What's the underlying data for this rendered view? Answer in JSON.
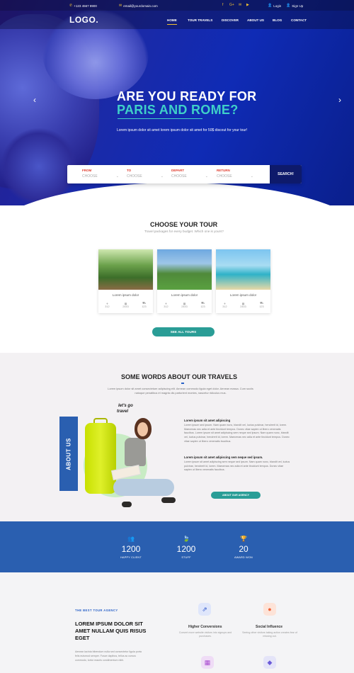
{
  "topbar": {
    "phone": "+123 4567 8900",
    "email": "email@yourdomain.com",
    "social": [
      "f",
      "G+",
      "✉",
      "▶"
    ],
    "login": "Login",
    "signup": "Sign Up"
  },
  "nav": {
    "logo": "LOGO.",
    "items": [
      "HOME",
      "TOUR TRAVELS",
      "DISCOVER",
      "ABOUT US",
      "BLOG",
      "CONTACT"
    ]
  },
  "hero": {
    "title_line1": "ARE YOU READY FOR",
    "title_line2": "PARIS AND ROME?",
    "subtitle": "Lorem ipsum dolor sit amet lorem ipsum dolor sit amet for 50$ discout for your tour!",
    "prev_arrow": "‹",
    "next_arrow": "›"
  },
  "search": {
    "fields": [
      {
        "label": "FROM",
        "value": "CHOOSE"
      },
      {
        "label": "TO",
        "value": "CHOOSE"
      },
      {
        "label": "DEPART",
        "value": "CHOOSE"
      },
      {
        "label": "RETURN",
        "value": "CHOOSE"
      }
    ],
    "button": "SEARCH!"
  },
  "tours": {
    "title": "CHOOSE YOUR TOUR",
    "subtitle": "Travel packages for every budget. Which one is yours?",
    "cards": [
      {
        "name": "Lorem ipsum dolor",
        "meta": [
          "312",
          "2443",
          "123"
        ]
      },
      {
        "name": "Lorem ipsum dolor",
        "meta": [
          "312",
          "2443",
          "123"
        ]
      },
      {
        "name": "Lorem ipsum dolor",
        "meta": [
          "312",
          "2443",
          "123"
        ]
      }
    ],
    "button": "SEE ALL TOURS"
  },
  "about": {
    "title": "SOME WORDS ABOUT OUR TRAVELS",
    "intro": "Lorem ipsum dolor sit amet consectetuer adipiscing elit. Aenean commodo ligula eget dolor. Aenean massa. Cum sociis natoque penatibus et magnis dis parturient montes, nascetur ridiculus mus.",
    "tab": "ABOUT US",
    "stamp": [
      "let's go",
      "travel"
    ],
    "heading1": "Lorem ipsum sit amet adipiscing",
    "para1": "Lorem ipsum sed ipsum. Nam quam nunc, blandit vel, luctus pulvinar, hendrerit id, lorem. Maecenas nec adia et ante tincidunt tempus. Donec vitae sapien ut libero venenatis faucibus. Lorem ipsum sit amet adipiscing sem neque sed ipsum. Nam quam nunc, blandit vel, luctus pulvinar, hendrerit id, lorem. Maecenas nec adia et ante tincidunt tempus. Donec vitae sapien ut libero venenatis faucibus.",
    "heading2": "Lorem ipsum sit amet adipiscing sem neque sed ipsum.",
    "para2": "Lorem ipsum sit amet adipiscing sem neque sed ipsum. Nam quam nunc, blandit vel, luctus pulvinar, hendrerit id, lorem. Maecenas nec adia et ante tincidunt tempus. Donec vitae sapien ut libero venenatis faucibus.",
    "button": "ABOUT OUR AGENCY"
  },
  "stats": [
    {
      "icon": "users-icon",
      "glyph": "👥",
      "value": "1200",
      "label": "HAPPY CLIENT"
    },
    {
      "icon": "leaf-icon",
      "glyph": "🍃",
      "value": "1200",
      "label": "STUFF"
    },
    {
      "icon": "trophy-icon",
      "glyph": "🏆",
      "value": "20",
      "label": "AWARD WON"
    }
  ],
  "features": {
    "kicker": "THE BEST TOUR AGENCY",
    "heading": "LOREM IPSUM DOLOR SIT AMET NULLAM QUIS RISUS EGET",
    "text": "Aenean lacinia bibendum nulla sed consectetur ligula porta felis euismod semper. Fusce dapibus, tellus ac cursus commodo, tortor mauris condimentum nibh.",
    "items": [
      {
        "icon": "arrows-icon",
        "glyph": "⇗",
        "title": "Higher Conversions",
        "desc": "Convert more website visitors into signups and purchases."
      },
      {
        "icon": "person-icon",
        "glyph": "●",
        "title": "Social Influence",
        "desc": "Seeing other visitors taking action creates fear of missing out."
      }
    ]
  },
  "colors": {
    "teal": "#2a9d96",
    "blue": "#2a5fb0",
    "accent_yellow": "#f2c230",
    "hero_title_teal": "#3fd0c8"
  }
}
